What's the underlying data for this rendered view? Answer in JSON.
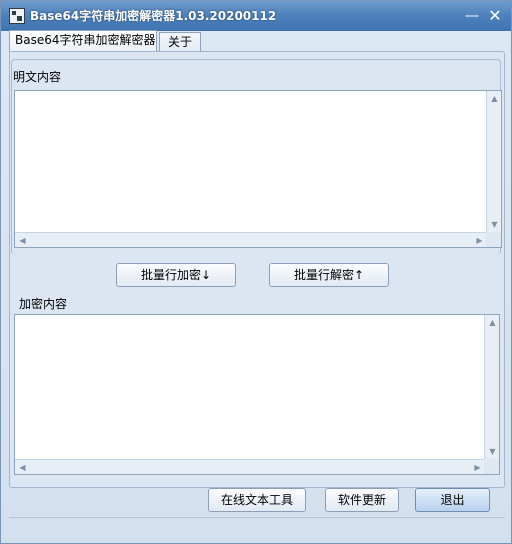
{
  "window": {
    "title": "Base64字符串加密解密器1.03.20200112",
    "minimize_glyph": "—",
    "close_glyph": "✕"
  },
  "tabs": [
    {
      "label": "Base64字符串加密解密器",
      "active": true
    },
    {
      "label": "关于",
      "active": false
    }
  ],
  "plaintext": {
    "label": "明文内容",
    "value": ""
  },
  "ciphertext": {
    "label": "加密内容",
    "value": ""
  },
  "actions": {
    "encrypt_label": "批量行加密↓",
    "decrypt_label": "批量行解密↑"
  },
  "footer": {
    "online_tools_label": "在线文本工具",
    "update_label": "软件更新",
    "exit_label": "退出"
  },
  "icons": {
    "scroll_up": "▲",
    "scroll_down": "▼",
    "scroll_left": "◀",
    "scroll_right": "▶"
  },
  "colors": {
    "titlebar": "#4f82bd",
    "window_bg": "#dce6f2",
    "exit_button": "#b8d1ee"
  }
}
